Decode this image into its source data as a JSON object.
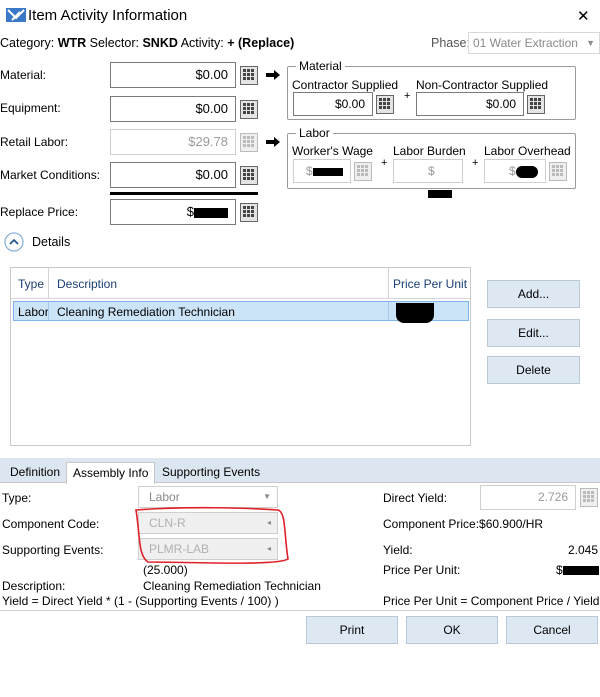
{
  "window": {
    "title": "Item Activity Information",
    "close_glyph": "✕"
  },
  "header": {
    "category_label": "Category:",
    "category_value": "WTR",
    "selector_label": "Selector:",
    "selector_value": "SNKD",
    "activity_label": "Activity:",
    "activity_value": "+ (Replace)",
    "phase_label": "Phase:",
    "phase_value": "01 Water Extraction"
  },
  "fields": {
    "material": {
      "label": "Material:",
      "value": "$0.00"
    },
    "equipment": {
      "label": "Equipment:",
      "value": "$0.00"
    },
    "retail_labor": {
      "label": "Retail Labor:",
      "value": "$29.78"
    },
    "market_conditions": {
      "label": "Market Conditions:",
      "value": "$0.00"
    },
    "replace_price": {
      "label": "Replace Price:",
      "value": "$"
    }
  },
  "material_group": {
    "title": "Material",
    "contractor_label": "Contractor Supplied",
    "contractor_value": "$0.00",
    "plus": "+",
    "noncontractor_label": "Non-Contractor Supplied",
    "noncontractor_value": "$0.00"
  },
  "labor_group": {
    "title": "Labor",
    "wage_label": "Worker's Wage",
    "wage_value": "$",
    "burden_label": "Labor Burden",
    "burden_value": "$",
    "overhead_label": "Labor Overhead",
    "overhead_value": "$",
    "plus": "+"
  },
  "details": {
    "toggle_label": "Details"
  },
  "table": {
    "columns": [
      "Type",
      "Description",
      "Price Per Unit"
    ],
    "rows": [
      {
        "type": "Labor",
        "description": "Cleaning Remediation Technician",
        "price": ""
      }
    ]
  },
  "side_buttons": {
    "add": "Add...",
    "edit": "Edit...",
    "delete": "Delete"
  },
  "tabs": [
    "Definition",
    "Assembly Info",
    "Supporting Events"
  ],
  "assembly": {
    "type_label": "Type:",
    "type_value": "Labor",
    "component_code_label": "Component Code:",
    "component_code_value": "CLN-R",
    "supporting_events_label": "Supporting Events:",
    "supporting_events_value": "PLMR-LAB",
    "supporting_events_total": "(25.000)",
    "description_label": "Description:",
    "description_value": "Cleaning Remediation Technician",
    "yield_formula": "Yield = Direct Yield * (1 - (Supporting Events / 100) )",
    "direct_yield_label": "Direct Yield:",
    "direct_yield_value": "2.726",
    "component_price_label": "Component Price:",
    "component_price_value": "$60.900/HR",
    "yield_label": "Yield:",
    "yield_value": "2.045",
    "price_per_unit_label": "Price Per Unit:",
    "price_per_unit_value": "$",
    "ppu_formula": "Price Per Unit = Component Price / Yield"
  },
  "footer": {
    "print": "Print",
    "ok": "OK",
    "cancel": "Cancel"
  },
  "colors": {
    "annotation": "#e0202a",
    "selection": "#cce4f7",
    "tab_bar": "#dbe6f1"
  },
  "icons": [
    "app-icon",
    "calculator-icon",
    "arrow-right-icon",
    "chevron-up-icon",
    "dropdown-arrow-icon"
  ]
}
